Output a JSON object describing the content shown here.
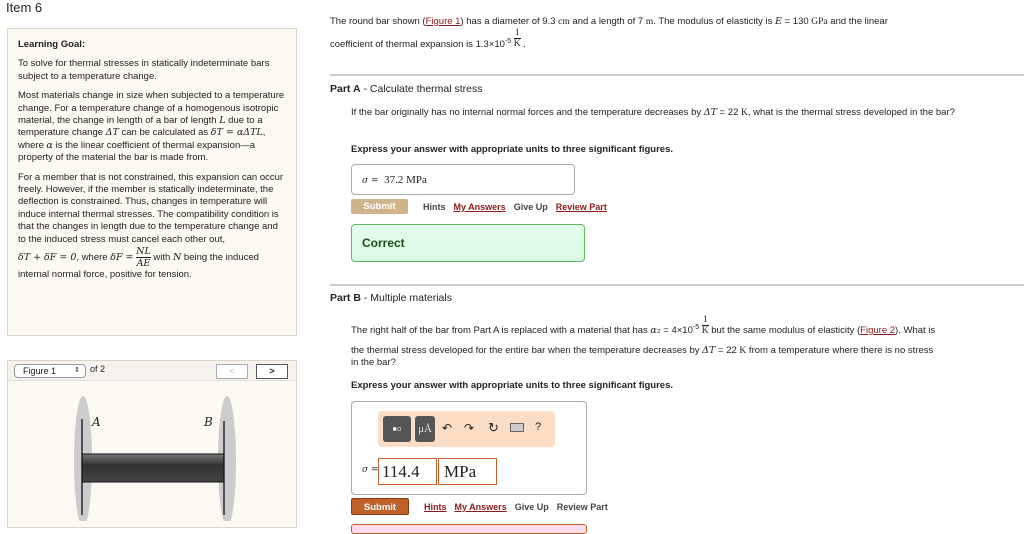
{
  "item_title": "Item 6",
  "goal": {
    "heading": "Learning Goal:",
    "p1": "To solve for thermal stresses in statically indeterminate bars subject to a temperature change.",
    "p2a": "Most materials change in size when subjected to a temperature change. For a temperature change of a homogenous isotropic material, the change in length of a bar of length ",
    "L": "L",
    "p2b": " due to a temperature change ",
    "dT": "ΔT",
    "p2c": " can be calculated as ",
    "eq1": "δT = αΔTL",
    "p2d": ", where ",
    "alpha": "α",
    "p2e": " is the linear coefficient of thermal expansion—a property of the material the bar is made from.",
    "p3": "For a member that is not constrained, this expansion can occur freely. However, if the member is statically indeterminate, the deflection is constrained. Thus, changes in temperature will induce internal thermal stresses. The compatibility condition is that the changes in length due to the temperature change and to the induced stress must cancel each other out,",
    "eq2": "δT + δF = 0",
    "where": ", where ",
    "eq3": "δF =",
    "num": "NL",
    "den": "AE",
    "with": " with ",
    "N": "N",
    "being": " being the induced internal normal force, positive for tension."
  },
  "figure": {
    "select": "Figure 1",
    "of": "of 2",
    "prev": "<",
    "next": ">",
    "label_a": "A",
    "label_b": "B"
  },
  "intro": {
    "t1": "The round bar shown (",
    "fig_link": "Figure 1",
    "t2": ") has a diameter of 9.3 ",
    "cm": "cm",
    "t3": " and a length of 7 ",
    "m": "m",
    "t4": ". The modulus of elasticity is ",
    "E": "E",
    "t5": " = 130 ",
    "GPa": "GPa",
    "t6": " and the linear",
    "t7": "coefficient of thermal expansion is 1.3×10",
    "exp": "-5",
    "one": "1",
    "K": "K",
    "t8": "."
  },
  "partA": {
    "label": "Part A",
    "title": " - Calculate thermal stress",
    "q1": "If the bar originally has no internal normal forces and the temperature decreases by ",
    "dT": "ΔT",
    "q2": " = 22 ",
    "K": "K",
    "q3": ", what is the thermal stress developed in the bar?",
    "instr": "Express your answer with appropriate units to three significant figures.",
    "sigma": "σ =",
    "answer": "37.2 MPa",
    "submit": "Submit",
    "hints": "Hints",
    "my_answers": "My Answers",
    "give_up": "Give Up",
    "review": "Review Part",
    "feedback": "Correct"
  },
  "partB": {
    "label": "Part B",
    "title": " - Multiple materials",
    "q1": "The right half of the bar from Part A is replaced with a material that has ",
    "a2": "α₂",
    "q2": " = 4×10",
    "exp": "-5",
    "one": "1",
    "K": "K",
    "q3": " but the same modulus of elasticity (",
    "fig_link": "Figure 2",
    "q4": "). What is",
    "q5": "the thermal stress developed for the entire bar when the temperature decreases by ",
    "dT": "ΔT",
    "q6": " = 22 ",
    "q7": " from a temperature where there is no stress",
    "q8": "in the bar?",
    "instr": "Express your answer with appropriate units to three significant figures.",
    "units_btn": "μÅ",
    "help": "?",
    "sigma": "σ =",
    "value": "114.4",
    "unit": "MPa",
    "submit": "Submit",
    "hints": "Hints",
    "my_answers": "My Answers",
    "give_up": "Give Up",
    "review": "Review Part"
  },
  "colors": {
    "submit_active": "#c0602a",
    "submit_disabled": "#d2b48c",
    "correct_bg": "#dffbe8",
    "correct_border": "#4caf50",
    "link": "#8b1a1a"
  }
}
